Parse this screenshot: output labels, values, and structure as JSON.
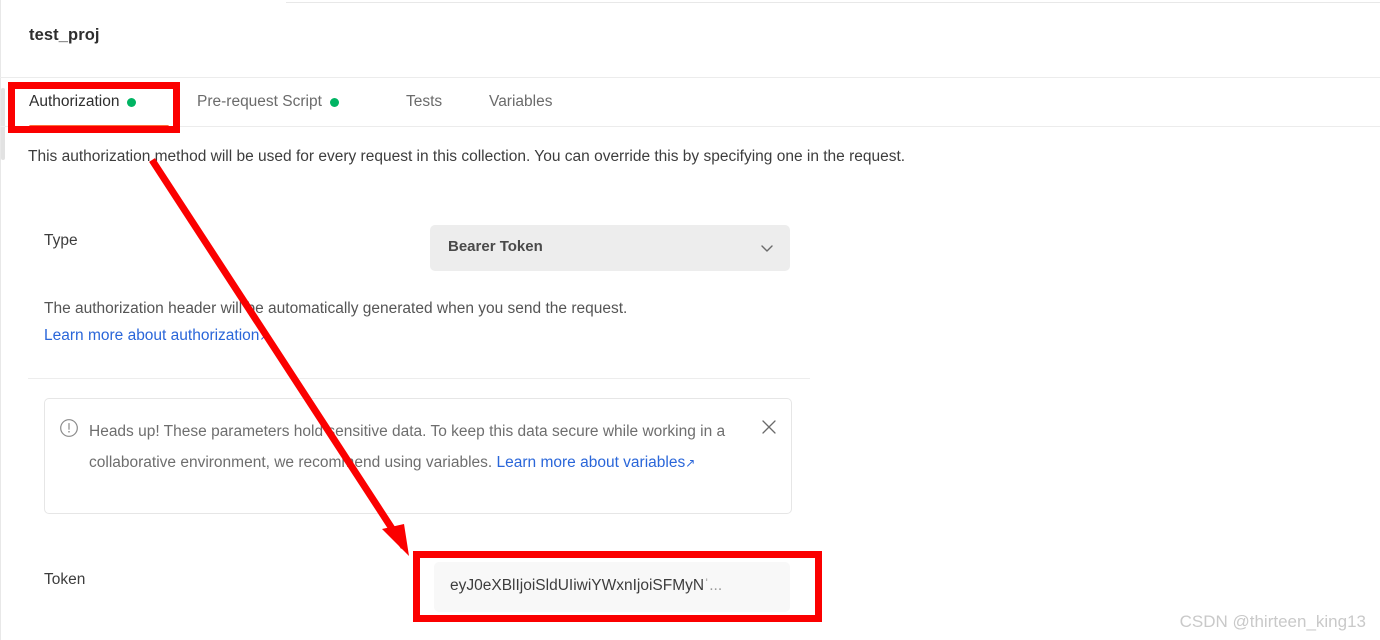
{
  "window": {
    "project_title": "test_proj"
  },
  "tabs": [
    {
      "label": "Authorization",
      "has_dot": true,
      "active": true
    },
    {
      "label": "Pre-request Script",
      "has_dot": true,
      "active": false
    },
    {
      "label": "Tests",
      "has_dot": false,
      "active": false
    },
    {
      "label": "Variables",
      "has_dot": false,
      "active": false
    }
  ],
  "main": {
    "description": "This authorization method will be used for every request in this collection. You can override this by specifying one in the request.",
    "type_label": "Type",
    "type_value": "Bearer Token",
    "header_note": "The authorization header will be automatically generated when you send the request.",
    "learn_more_auth": "Learn more about authorization",
    "external_link_glyph": "↗"
  },
  "alert": {
    "icon": "exclamation-circle-icon",
    "text_part1": "Heads up! These parameters hold sensitive data. To keep this data secure while working in a collaborative environment, we recommend using variables. ",
    "link_label": "Learn more about variables",
    "close_label": "✕"
  },
  "token": {
    "label": "Token",
    "value": "eyJ0eXBlIjoiSldUIiwiYWxnIjoiSFMyN",
    "ellipsis": "ˈ..."
  },
  "watermark": {
    "text": "CSDN @thirteen_king13"
  },
  "colors": {
    "accent_orange": "#ff6c37",
    "status_green": "#00b463",
    "link_blue": "#2a66d9",
    "annotation_red": "#fb0000"
  }
}
